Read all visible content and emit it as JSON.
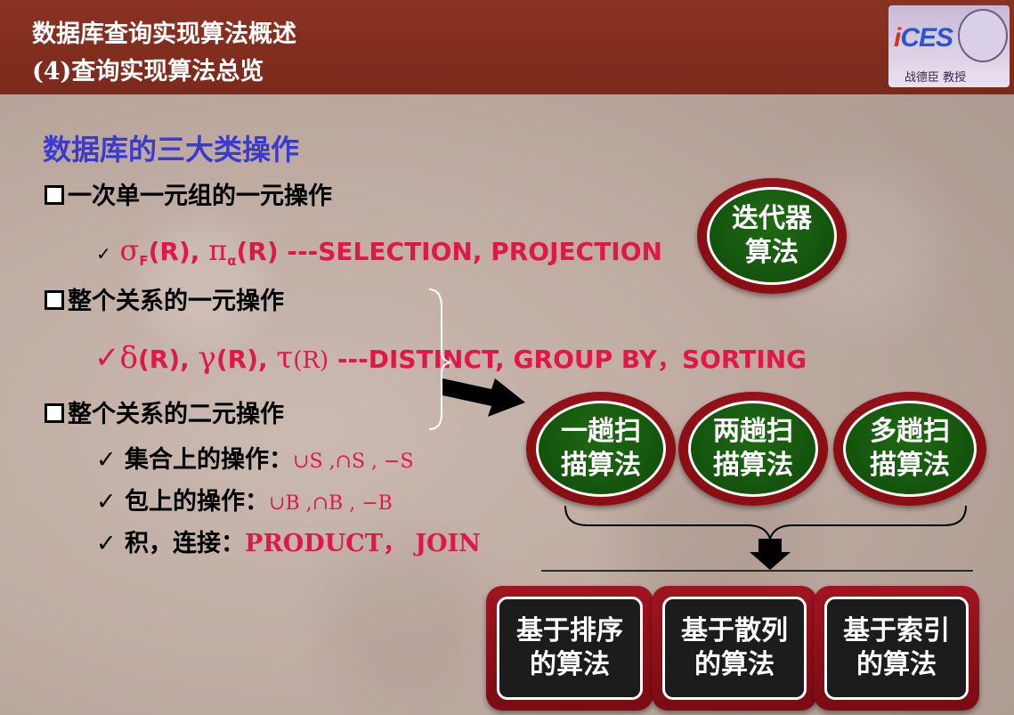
{
  "header": {
    "title_line1": "数据库查询实现算法概述",
    "title_line2": "(4)查询实现算法总览",
    "logo_text_prefix": "i",
    "logo_text_main": "CES",
    "logo_signature": "战德臣 教授"
  },
  "content": {
    "heading": "数据库的三大类操作",
    "item1": "一次单一元组的一元操作",
    "item1_detail": {
      "check": "✓",
      "sigma": "σ",
      "sigma_sub": "F",
      "r1": "(R), ",
      "pi": "π",
      "pi_sub": "α",
      "r2": "(R)",
      "desc": " ---SELECTION, PROJECTION"
    },
    "item2": "整个关系的一元操作",
    "item2_detail": {
      "check": "✓",
      "delta": "δ",
      "r1": "(R), ",
      "gamma": "γ",
      "r2": "(R), ",
      "tau": "τ",
      "r3": "(R)",
      "desc": " ---DISTINCT, GROUP BY，SORTING"
    },
    "item3": "整个关系的二元操作",
    "set_ops": {
      "check": "✓",
      "label": " 集合上的操作：",
      "ops": "∪S ,∩S , −S"
    },
    "bag_ops": {
      "check": "✓",
      "label": " 包上的操作：",
      "ops": "∪B ,∩B , −B"
    },
    "product": {
      "check": "✓",
      "label": " 积，连接：",
      "ops": "PRODUCT，  JOIN"
    }
  },
  "ovals": {
    "iterator": [
      "迭代器",
      "算法"
    ],
    "one_pass": [
      "一趟扫",
      "描算法"
    ],
    "two_pass": [
      "两趟扫",
      "描算法"
    ],
    "multi_pass": [
      "多趟扫",
      "描算法"
    ]
  },
  "boxes": {
    "sort_based": [
      "基于排序",
      "的算法"
    ],
    "hash_based": [
      "基于散列",
      "的算法"
    ],
    "index_based": [
      "基于索引",
      "的算法"
    ]
  },
  "colors": {
    "header_bg": "#7a2a1c",
    "heading_blue": "#3a3ad0",
    "accent_pink": "#e0184a",
    "oval_red": "#8a0e14",
    "oval_green": "#0f4a0a"
  }
}
